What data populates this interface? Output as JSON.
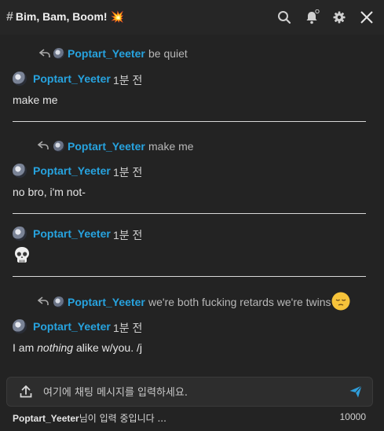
{
  "header": {
    "title": "Bim, Bam, Boom! 💥",
    "icons": [
      "search-icon",
      "bell-icon",
      "gear-icon",
      "close-icon"
    ]
  },
  "messages": {
    "top_partial_reply": {
      "user": "Poptart_Yeeter",
      "text": "be quiet"
    },
    "m1": {
      "user": "Poptart_Yeeter",
      "time": "1분 전",
      "text": "make me"
    },
    "m2": {
      "reply_user": "Poptart_Yeeter",
      "reply_text": "make me",
      "user": "Poptart_Yeeter",
      "time": "1분 전",
      "text": "no bro, i'm not-"
    },
    "m3": {
      "user": "Poptart_Yeeter",
      "time": "1분 전",
      "emoji": "skull"
    },
    "m4": {
      "reply_user": "Poptart_Yeeter",
      "reply_text": "we're both fucking retards we're twins",
      "reply_emoji": "pensive-face",
      "user": "Poptart_Yeeter",
      "time": "1분 전",
      "text_pre": "I am ",
      "text_em": "nothing",
      "text_post": " alike w/you. /j"
    }
  },
  "composer": {
    "placeholder": "여기에 채팅 메시지를 입력하세요."
  },
  "footer": {
    "typing_user": "Poptart_Yeeter",
    "typing_suffix": "님이 입력 중입니다 ...",
    "char_limit": "10000"
  },
  "colors": {
    "accent": "#27a3df",
    "background": "#232323"
  }
}
